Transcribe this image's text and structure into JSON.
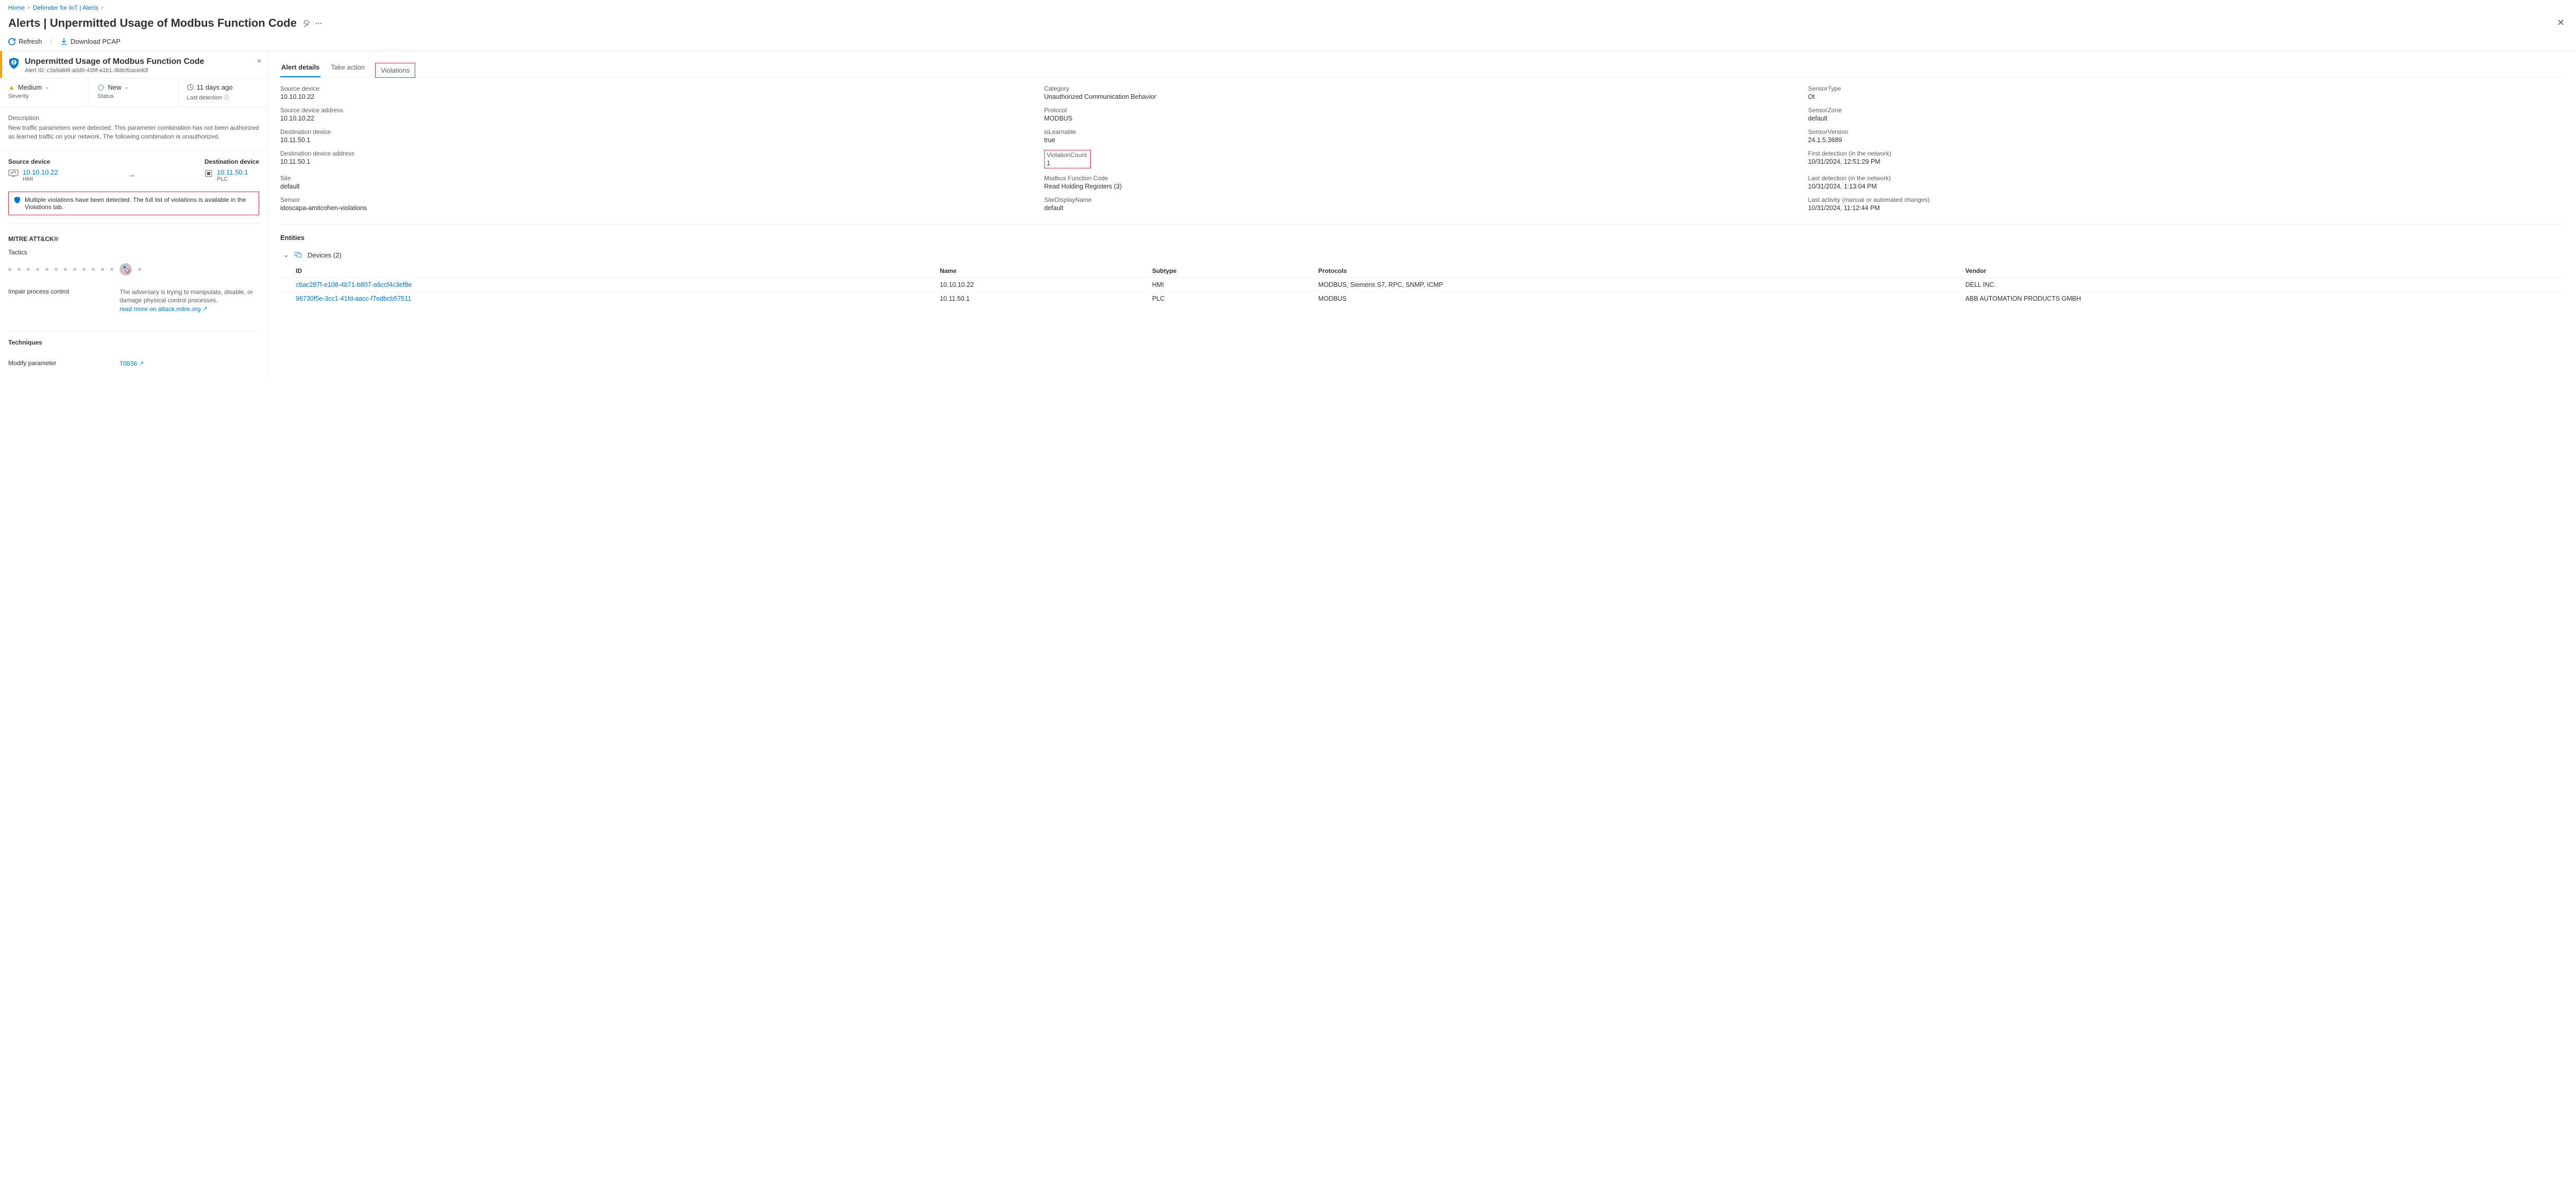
{
  "breadcrumb": {
    "home": "Home",
    "defender": "Defender for IoT | Alerts",
    "sep": "›"
  },
  "title": {
    "prefix": "Alerts | ",
    "name": "Unpermitted Usage of Modbus Function Code"
  },
  "commands": {
    "refresh": "Refresh",
    "download_pcap": "Download PCAP"
  },
  "alert_header": {
    "title": "Unpermitted Usage of Modbus Function Code",
    "alert_id_label": "Alert ID: ",
    "alert_id": "c3a9a66f-a0d0-439f-a1b1-3b8cf0aced0f"
  },
  "status_row": {
    "severity_value": "Medium",
    "severity_label": "Severity",
    "new_value": "New",
    "status_label": "Status",
    "detection_value": "11 days ago",
    "detection_label": "Last detection"
  },
  "description": {
    "label": "Description",
    "text": "New traffic parameters were detected. This parameter combination has not been authorized as learned traffic on your network. The following combination is unauthorized."
  },
  "devices": {
    "source_label": "Source device",
    "source_ip": "10.10.10.22",
    "source_type": "HMI",
    "dest_label": "Destination device",
    "dest_ip": "10.11.50.1",
    "dest_type": "PLC"
  },
  "note": "Multiple violations have been detected. The full list of violations is available in the Violations tab.",
  "mitre": {
    "title": "MITRE ATT&CK®",
    "tactics_label": "Tactics",
    "impair": "Impair process control",
    "impair_desc": "The adversary is trying to manipulate, disable, or damage physical control processes.",
    "read_more": "read more on attack.mitre.org",
    "techniques_label": "Techniques",
    "modify_param": "Modify parameter",
    "t0836": "T0836"
  },
  "tabs": {
    "details": "Alert details",
    "take_action": "Take action",
    "violations": "Violations"
  },
  "details": {
    "source_device": {
      "label": "Source device",
      "value": "10.10.10.22"
    },
    "category": {
      "label": "Category",
      "value": "Unauthorized Communication Behavior"
    },
    "sensor_type": {
      "label": "SensorType",
      "value": "Ot"
    },
    "source_addr": {
      "label": "Source device address",
      "value": "10.10.10.22"
    },
    "protocol": {
      "label": "Protocol",
      "value": "MODBUS"
    },
    "sensor_zone": {
      "label": "SensorZone",
      "value": "default"
    },
    "dest_device": {
      "label": "Destination device",
      "value": "10.11.50.1"
    },
    "learnable": {
      "label": "isLearnable",
      "value": "true"
    },
    "sensor_version": {
      "label": "SensorVersion",
      "value": "24.1.5.3689"
    },
    "dest_addr": {
      "label": "Destination device address",
      "value": "10.11.50.1"
    },
    "violation_count": {
      "label": "ViolationCount",
      "value": "1"
    },
    "first_detection": {
      "label": "First detection (in the network)",
      "value": "10/31/2024, 12:51:29 PM"
    },
    "site": {
      "label": "Site",
      "value": "default"
    },
    "func_code": {
      "label": "Modbus Function Code",
      "value": "Read Holding Registers (3)"
    },
    "last_detection": {
      "label": "Last detection (in the network)",
      "value": "10/31/2024, 1:13:04 PM"
    },
    "sensor": {
      "label": "Sensor",
      "value": "idoscapa-amitcohen-violations"
    },
    "site_display": {
      "label": "SiteDisplayName",
      "value": "default"
    },
    "last_activity": {
      "label": "Last activity (manual or automated changes)",
      "value": "10/31/2024, 11:12:44 PM"
    }
  },
  "entities": {
    "section_title": "Entities",
    "group_label": "Devices (2)",
    "headers": {
      "id": "ID",
      "name": "Name",
      "subtype": "Subtype",
      "protocols": "Protocols",
      "vendor": "Vendor"
    },
    "rows": [
      {
        "id": "c6ac287f-e108-4b71-b807-a6ccf4c3ef8e",
        "name": "10.10.10.22",
        "subtype": "HMI",
        "protocols": "MODBUS, Siemens S7, RPC, SNMP, ICMP",
        "vendor": "DELL INC."
      },
      {
        "id": "96730f5e-3cc1-41fd-aacc-f7edbcb57511",
        "name": "10.11.50.1",
        "subtype": "PLC",
        "protocols": "MODBUS",
        "vendor": "ABB AUTOMATION PRODUCTS GMBH"
      }
    ]
  }
}
